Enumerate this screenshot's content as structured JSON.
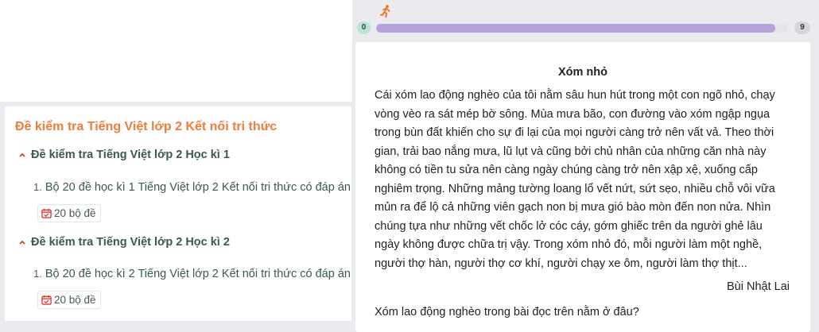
{
  "left": {
    "title": "Đề kiểm tra Tiếng Việt lớp 2 Kết nối tri thức",
    "sections": [
      {
        "heading": "Đề kiểm tra Tiếng Việt lớp 2 Học kì 1",
        "item_number": "1.",
        "item_text": "Bộ 20 đề học kì 1 Tiếng Việt lớp 2 Kết nối tri thức có đáp án",
        "badge": "20 bộ đề"
      },
      {
        "heading": "Đề kiểm tra Tiếng Việt lớp 2 Học kì 2",
        "item_number": "1.",
        "item_text": "Bộ 20 đề học kì 2 Tiếng Việt lớp 2 Kết nối tri thức có đáp án",
        "badge": "20 bộ đề"
      }
    ],
    "icons": {
      "section_toggle": "chevron-up-icon",
      "badge": "calendar-check-icon"
    },
    "colors": {
      "title": "#ee7d3a",
      "heading": "#3b5a4a",
      "chevron": "#e23a35"
    }
  },
  "quiz": {
    "runner_icon": "runner-icon",
    "progress": {
      "start": "0",
      "end": "9",
      "fraction": 0.97
    },
    "colors": {
      "progress_fill": "#b4a2da",
      "start_badge": "#b8e5d5",
      "runner": "#f07a2a"
    },
    "passage": {
      "title": "Xóm nhỏ",
      "lines": [
        "Cái xóm lao động nghèo của tôi nằm sâu hun hút trong một con ngõ nhỏ, chạy",
        "vòng vèo ra sát mép bờ sông. Mùa mưa bão, con đường vào xóm ngập ngụa",
        "trong bùn đất khiến cho sự đi lại của mọi người càng trở nên vất vả. Theo thời",
        "gian, trải bao nắng mưa, lũ lụt và cũng bởi chủ nhân của những căn nhà này",
        "không có tiền tu sửa nên càng ngày chúng càng trở nên xập xệ, xuống cấp",
        "nghiêm trọng. Những mảng tường loang lổ vết nứt, sứt sẹo, nhiều chỗ vôi vữa",
        "mủn ra để lộ cả những viên gạch non bị mưa gió bào mòn đến non nửa. Nhìn",
        "chúng tựa như những vết chốc lở cóc cáy, gớm ghiếc trên da người ghẻ lâu",
        "ngày không được chữa trị vậy. Trong xóm nhỏ đó, mỗi người làm một nghề,",
        "người thợ hàn, người thợ cơ khí, người chạy xe ôm, người làm thợ thịt..."
      ],
      "author": "Bùi Nhật Lai"
    },
    "question": "Xóm lao động nghèo trong bài đọc trên nằm ở đâu?"
  }
}
